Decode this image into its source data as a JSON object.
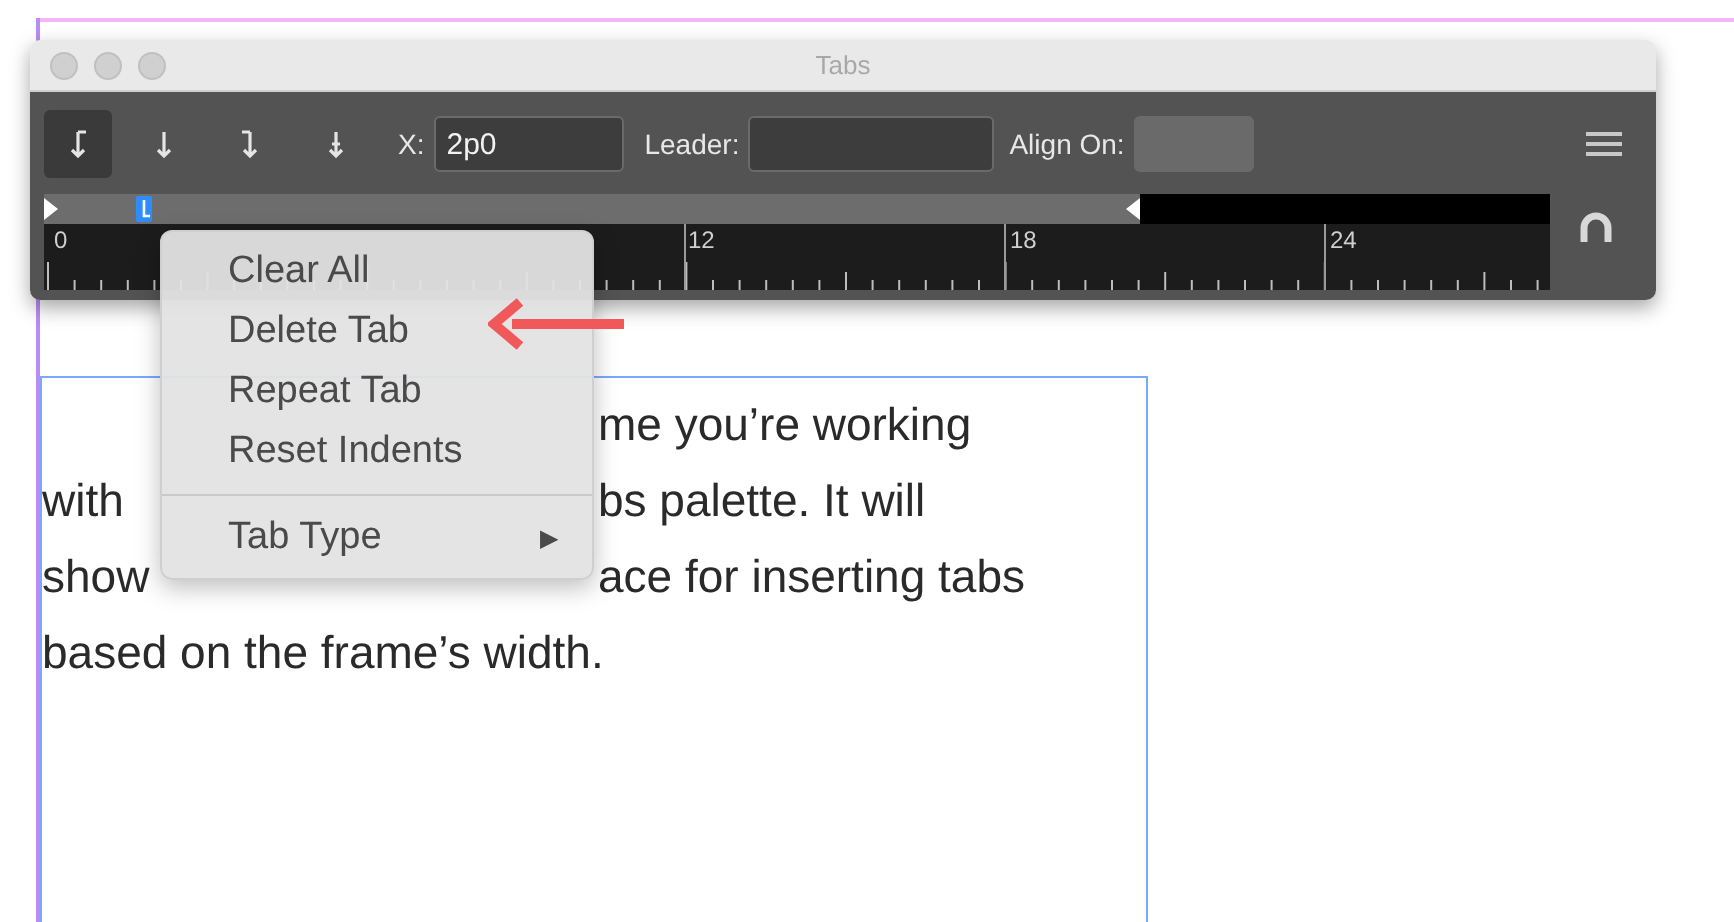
{
  "window": {
    "title": "Tabs"
  },
  "toolbar": {
    "tab_buttons": [
      {
        "selected": true
      },
      {
        "selected": false
      },
      {
        "selected": false
      },
      {
        "selected": false
      }
    ],
    "x_field": {
      "label": "X:",
      "value": "2p0"
    },
    "leader_field": {
      "label": "Leader:"
    },
    "align_field": {
      "label": "Align On:",
      "disabled": true
    }
  },
  "ruler": {
    "labels": [
      "0",
      "12",
      "18",
      "24"
    ]
  },
  "context_menu": {
    "items": [
      {
        "kind": "item",
        "label": "Clear All"
      },
      {
        "kind": "item",
        "label": "Delete Tab"
      },
      {
        "kind": "item",
        "label": "Repeat Tab"
      },
      {
        "kind": "item",
        "label": "Reset Indents"
      },
      {
        "kind": "separator"
      },
      {
        "kind": "submenu",
        "label": "Tab Type",
        "arrow": "▶"
      }
    ]
  },
  "text_frame": {
    "lines": [
      {
        "right": "me you’re working"
      },
      {
        "left": "with",
        "right": "bs palette. It will"
      },
      {
        "left": "show",
        "right": "ace for inserting tabs"
      },
      {
        "left": "based on the frame’s width."
      }
    ]
  }
}
